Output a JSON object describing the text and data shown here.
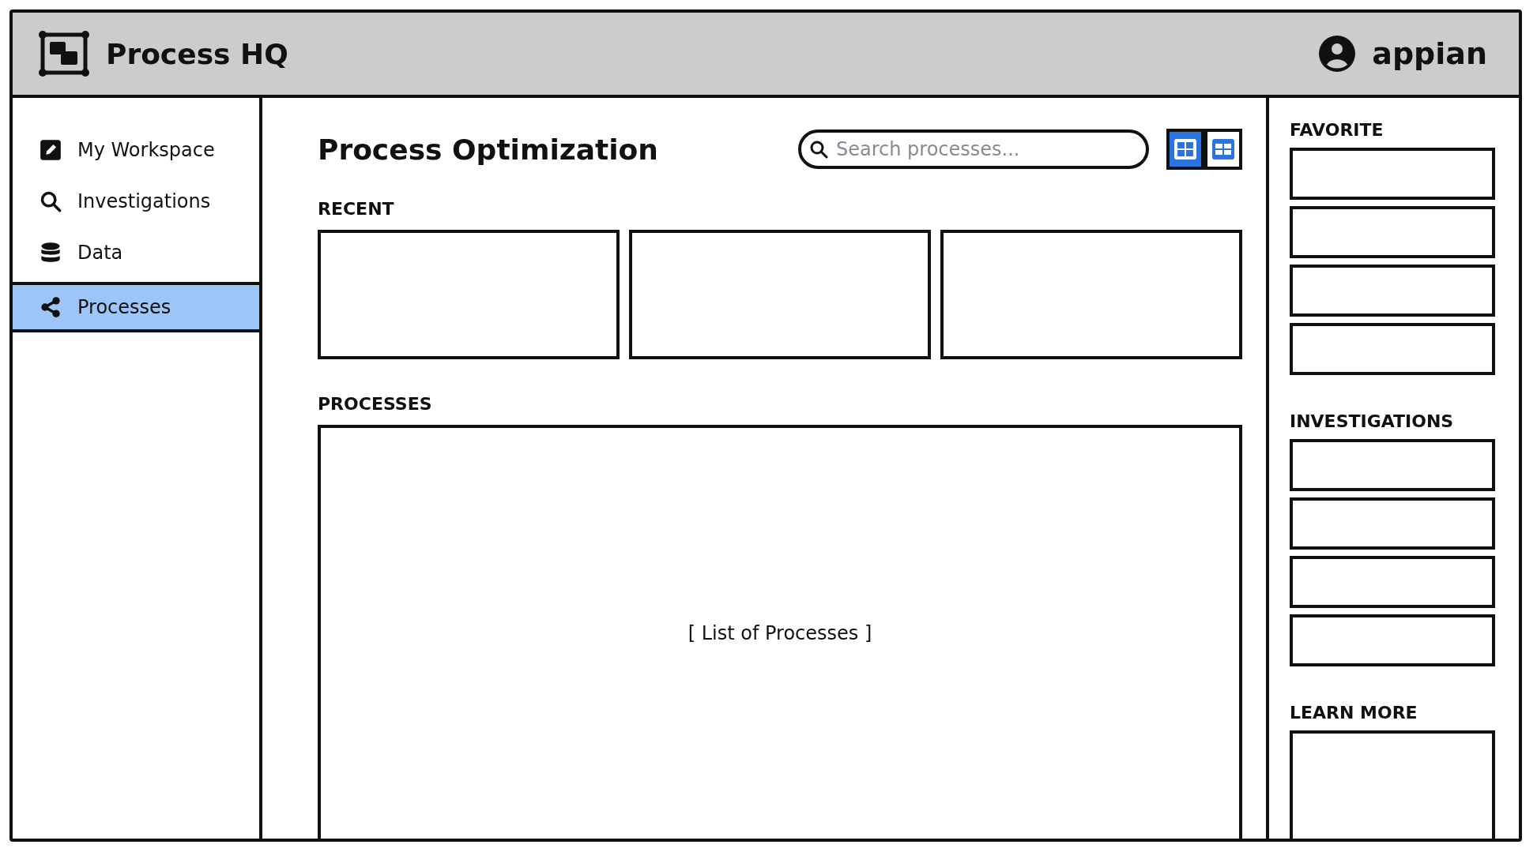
{
  "header": {
    "title": "Process HQ",
    "brand": "appian"
  },
  "sidebar": {
    "items": [
      {
        "label": "My Workspace",
        "selected": false
      },
      {
        "label": "Investigations",
        "selected": false
      },
      {
        "label": "Data",
        "selected": false
      },
      {
        "label": "Processes",
        "selected": true
      }
    ]
  },
  "main": {
    "title": "Process Optimization",
    "search": {
      "placeholder": "Search processes..."
    },
    "view_toggle": [
      {
        "selected": true
      },
      {
        "selected": false
      }
    ],
    "recent": {
      "label": "RECENT",
      "cards": [
        {
          "kind": "placeholder"
        },
        {
          "kind": "placeholder"
        },
        {
          "kind": "placeholder"
        }
      ]
    },
    "processes": {
      "label": "PROCESSES",
      "content": "[ List of Processes ]"
    }
  },
  "right_panel": {
    "sections": [
      {
        "label": "FAVORITE",
        "items": [
          {
            "kind": "placeholder"
          },
          {
            "kind": "placeholder"
          },
          {
            "kind": "placeholder"
          },
          {
            "kind": "placeholder"
          }
        ]
      },
      {
        "label": "INVESTIGATIONS",
        "items": [
          {
            "kind": "placeholder"
          },
          {
            "kind": "placeholder"
          },
          {
            "kind": "placeholder"
          },
          {
            "kind": "placeholder"
          }
        ]
      },
      {
        "label": "LEARN MORE",
        "items": [
          {
            "kind": "large"
          }
        ]
      }
    ]
  }
}
